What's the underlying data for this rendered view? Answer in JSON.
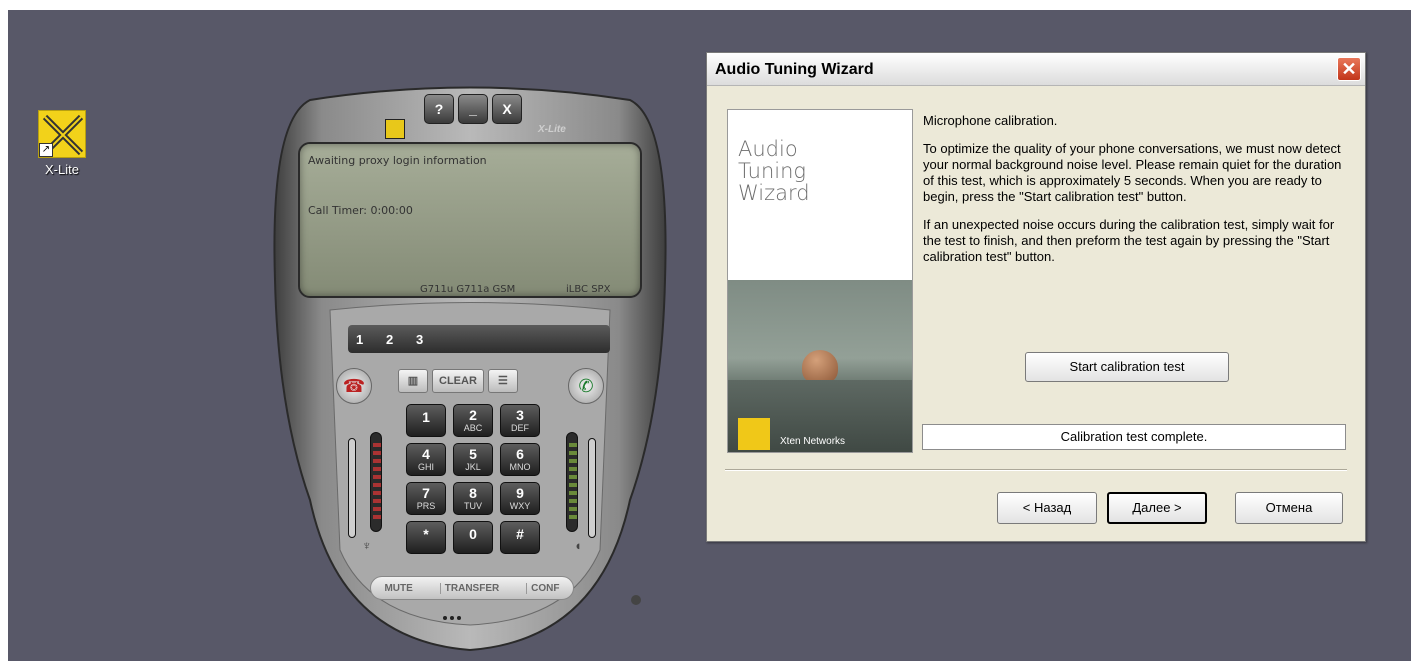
{
  "desktop": {
    "shortcut": {
      "label": "X-Lite",
      "icon": "x-lite-logo-icon"
    }
  },
  "phone": {
    "top_buttons": [
      "?",
      "_",
      "X"
    ],
    "brand": "X-Lite",
    "lcd": {
      "status": "Awaiting proxy login information",
      "timer": "Call Timer: 0:00:00",
      "codecs_left": "G711u G711a GSM",
      "codecs_right": "iLBC SPX"
    },
    "lines": [
      "1",
      "2",
      "3"
    ],
    "clear_label": "CLEAR",
    "keys": [
      {
        "d": "1",
        "l": ""
      },
      {
        "d": "2",
        "l": "ABC"
      },
      {
        "d": "3",
        "l": "DEF"
      },
      {
        "d": "4",
        "l": "GHI"
      },
      {
        "d": "5",
        "l": "JKL"
      },
      {
        "d": "6",
        "l": "MNO"
      },
      {
        "d": "7",
        "l": "PRS"
      },
      {
        "d": "8",
        "l": "TUV"
      },
      {
        "d": "9",
        "l": "WXY"
      },
      {
        "d": "*",
        "l": ""
      },
      {
        "d": "0",
        "l": ""
      },
      {
        "d": "#",
        "l": ""
      }
    ],
    "bottom": {
      "mute": "MUTE",
      "transfer": "TRANSFER",
      "conf": "CONF"
    }
  },
  "dialog": {
    "title": "Audio Tuning Wizard",
    "banner_title": "Audio\nTuning\nWizard",
    "banner_brand": "Xten Networks",
    "heading": "Microphone calibration.",
    "para1": "To optimize the quality of your phone conversations, we must now detect your normal background noise level. Please remain quiet for the duration of this test, which is approximately 5 seconds.  When you are ready to begin, press the \"Start calibration test\" button.",
    "para2": "If an unexpected noise occurs during the calibration test, simply wait for the test to finish, and then preform the test again by pressing the \"Start calibration test\" button.",
    "start_button": "Start calibration test",
    "status": "Calibration test complete.",
    "back_button": "< Назад",
    "next_button": "Далее >",
    "cancel_button": "Отмена"
  }
}
